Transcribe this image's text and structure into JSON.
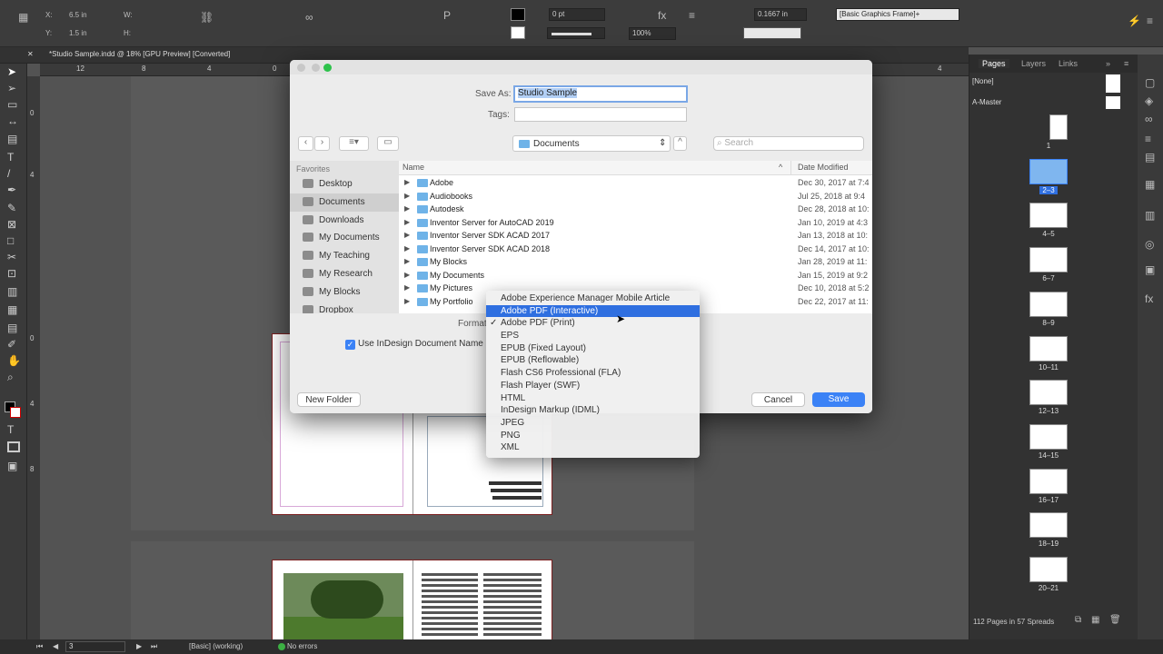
{
  "control_panel": {
    "x_label": "X:",
    "x_value": "6.5 in",
    "y_label": "Y:",
    "y_value": "1.5 in",
    "w_label": "W:",
    "h_label": "H:",
    "stroke_weight": "0 pt",
    "scale_percent": "100%",
    "stroke_offset": "0.1667 in",
    "frame_style": "[Basic Graphics Frame]+"
  },
  "document_tab": "*Studio Sample.indd @ 18% [GPU Preview] [Converted]",
  "ruler": {
    "h_ticks": [
      "12",
      "8",
      "4",
      "0",
      "4"
    ],
    "v_ticks": [
      "0",
      "4",
      "0",
      "4",
      "8"
    ]
  },
  "pages_panel": {
    "tabs": [
      "Pages",
      "Layers",
      "Links"
    ],
    "none_label": "[None]",
    "master_label": "A-Master",
    "page_labels": [
      "1",
      "2–3",
      "4–5",
      "6–7",
      "8–9",
      "10–11",
      "12–13",
      "14–15",
      "16–17",
      "18–19",
      "20–21"
    ],
    "summary": "112 Pages in 57 Spreads"
  },
  "dialog": {
    "save_as_label": "Save As:",
    "save_as_value": "Studio Sample",
    "tags_label": "Tags:",
    "location": "Documents",
    "search_placeholder": "Search",
    "favorites_label": "Favorites",
    "favorites": [
      "Desktop",
      "Documents",
      "Downloads",
      "My Documents",
      "My Teaching",
      "My Research",
      "My Blocks",
      "Dropbox"
    ],
    "col_name": "Name",
    "col_date": "Date Modified",
    "files": [
      {
        "name": "Adobe",
        "date": "Dec 30, 2017 at 7:4"
      },
      {
        "name": "Audiobooks",
        "date": "Jul 25, 2018 at 9:4"
      },
      {
        "name": "Autodesk",
        "date": "Dec 28, 2018 at 10:"
      },
      {
        "name": "Inventor Server for AutoCAD 2019",
        "date": "Jan 10, 2019 at 4:3"
      },
      {
        "name": "Inventor Server SDK ACAD 2017",
        "date": "Jan 13, 2018 at 10:"
      },
      {
        "name": "Inventor Server SDK ACAD 2018",
        "date": "Dec 14, 2017 at 10:"
      },
      {
        "name": "My Blocks",
        "date": "Jan 28, 2019 at 11:"
      },
      {
        "name": "My Documents",
        "date": "Jan 15, 2019 at 9:2"
      },
      {
        "name": "My Pictures",
        "date": "Dec 10, 2018 at 5:2"
      },
      {
        "name": "My Portfolio",
        "date": "Dec 22, 2017 at 11:"
      }
    ],
    "format_label": "Format",
    "use_name_label": "Use InDesign Document Name",
    "new_folder": "New Folder",
    "cancel": "Cancel",
    "save": "Save"
  },
  "format_menu": {
    "items": [
      "Adobe Experience Manager Mobile Article",
      "Adobe PDF (Interactive)",
      "Adobe PDF (Print)",
      "EPS",
      "EPUB (Fixed Layout)",
      "EPUB (Reflowable)",
      "Flash CS6 Professional (FLA)",
      "Flash Player (SWF)",
      "HTML",
      "InDesign Markup (IDML)",
      "JPEG",
      "PNG",
      "XML"
    ],
    "highlighted": "Adobe PDF (Interactive)",
    "checked": "Adobe PDF (Print)"
  },
  "status_bar": {
    "page": "3",
    "preflight_profile": "[Basic] (working)",
    "errors": "No errors"
  },
  "colors": {
    "accent": "#2f6fe0",
    "save_button": "#3b82f6",
    "folder": "#6fb3e8",
    "status_ok": "#3cb043"
  }
}
